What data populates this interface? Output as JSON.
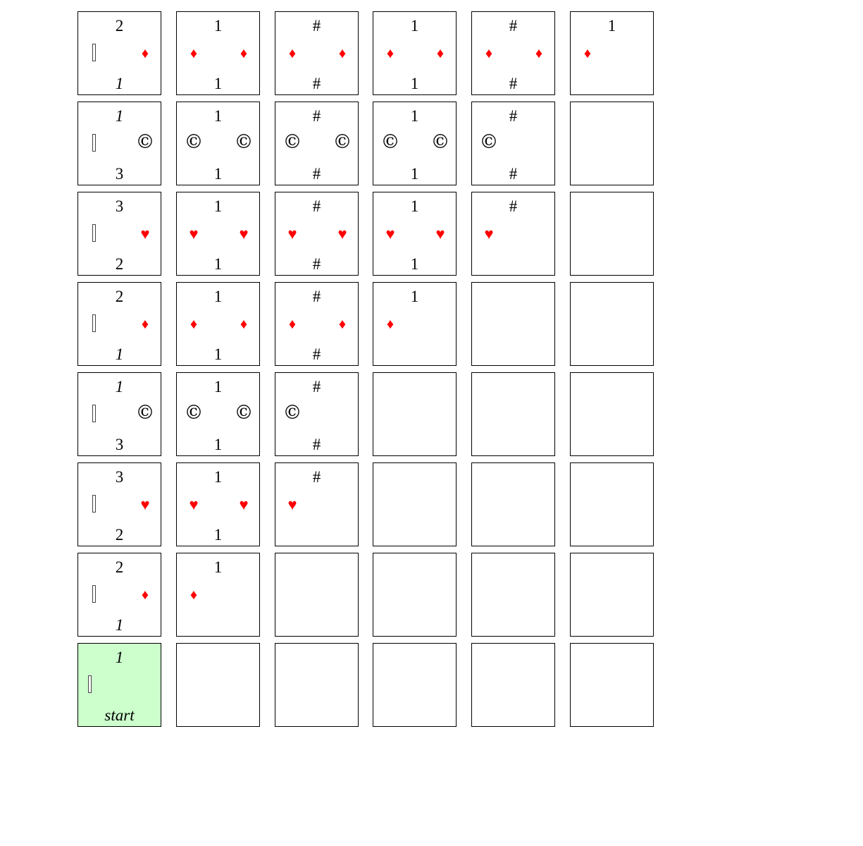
{
  "colors": {
    "suit_red": "#ff0000",
    "ink": "#000000",
    "start_fill": "#ccffcc"
  },
  "suits": {
    "diamond": {
      "glyph": "♦",
      "color": "#ff0000",
      "icon": "diamond-icon"
    },
    "heart": {
      "glyph": "♥",
      "color": "#ff0000",
      "icon": "heart-icon"
    },
    "copyright": {
      "glyph": "©",
      "color": "#000000",
      "icon": "copyright-icon"
    }
  },
  "grid": {
    "rows": 8,
    "cols": 6,
    "cells": [
      [
        {
          "top": "2",
          "bottom": "1",
          "bottom_italic": true,
          "bar": true,
          "right": "diamond"
        },
        {
          "top": "1",
          "bottom": "1",
          "left": "diamond",
          "right": "diamond"
        },
        {
          "top": "#",
          "bottom": "#",
          "left": "diamond",
          "right": "diamond"
        },
        {
          "top": "1",
          "bottom": "1",
          "left": "diamond",
          "right": "diamond"
        },
        {
          "top": "#",
          "bottom": "#",
          "left": "diamond",
          "right": "diamond"
        },
        {
          "top": "1",
          "left": "diamond"
        }
      ],
      [
        {
          "top": "1",
          "top_italic": true,
          "bottom": "3",
          "bar": true,
          "right": "copyright"
        },
        {
          "top": "1",
          "bottom": "1",
          "left": "copyright",
          "right": "copyright"
        },
        {
          "top": "#",
          "bottom": "#",
          "left": "copyright",
          "right": "copyright"
        },
        {
          "top": "1",
          "bottom": "1",
          "left": "copyright",
          "right": "copyright"
        },
        {
          "top": "#",
          "bottom": "#",
          "left": "copyright"
        },
        {}
      ],
      [
        {
          "top": "3",
          "bottom": "2",
          "bar": true,
          "right": "heart"
        },
        {
          "top": "1",
          "bottom": "1",
          "left": "heart",
          "right": "heart"
        },
        {
          "top": "#",
          "bottom": "#",
          "left": "heart",
          "right": "heart"
        },
        {
          "top": "1",
          "bottom": "1",
          "left": "heart",
          "right": "heart"
        },
        {
          "top": "#",
          "left": "heart"
        },
        {}
      ],
      [
        {
          "top": "2",
          "bottom": "1",
          "bottom_italic": true,
          "bar": true,
          "right": "diamond"
        },
        {
          "top": "1",
          "bottom": "1",
          "left": "diamond",
          "right": "diamond"
        },
        {
          "top": "#",
          "bottom": "#",
          "left": "diamond",
          "right": "diamond"
        },
        {
          "top": "1",
          "left": "diamond"
        },
        {},
        {}
      ],
      [
        {
          "top": "1",
          "top_italic": true,
          "bottom": "3",
          "bar": true,
          "right": "copyright"
        },
        {
          "top": "1",
          "bottom": "1",
          "left": "copyright",
          "right": "copyright"
        },
        {
          "top": "#",
          "bottom": "#",
          "left": "copyright"
        },
        {},
        {},
        {}
      ],
      [
        {
          "top": "3",
          "bottom": "2",
          "bar": true,
          "right": "heart"
        },
        {
          "top": "1",
          "bottom": "1",
          "left": "heart",
          "right": "heart"
        },
        {
          "top": "#",
          "left": "heart"
        },
        {},
        {},
        {}
      ],
      [
        {
          "top": "2",
          "bottom": "1",
          "bottom_italic": true,
          "bar": true,
          "right": "diamond"
        },
        {
          "top": "1",
          "left": "diamond"
        },
        {},
        {},
        {},
        {}
      ],
      [
        {
          "top": "1",
          "top_italic": true,
          "bottom": "start",
          "bottom_italic": true,
          "bar": true,
          "start": true
        },
        {},
        {},
        {},
        {},
        {}
      ]
    ]
  }
}
